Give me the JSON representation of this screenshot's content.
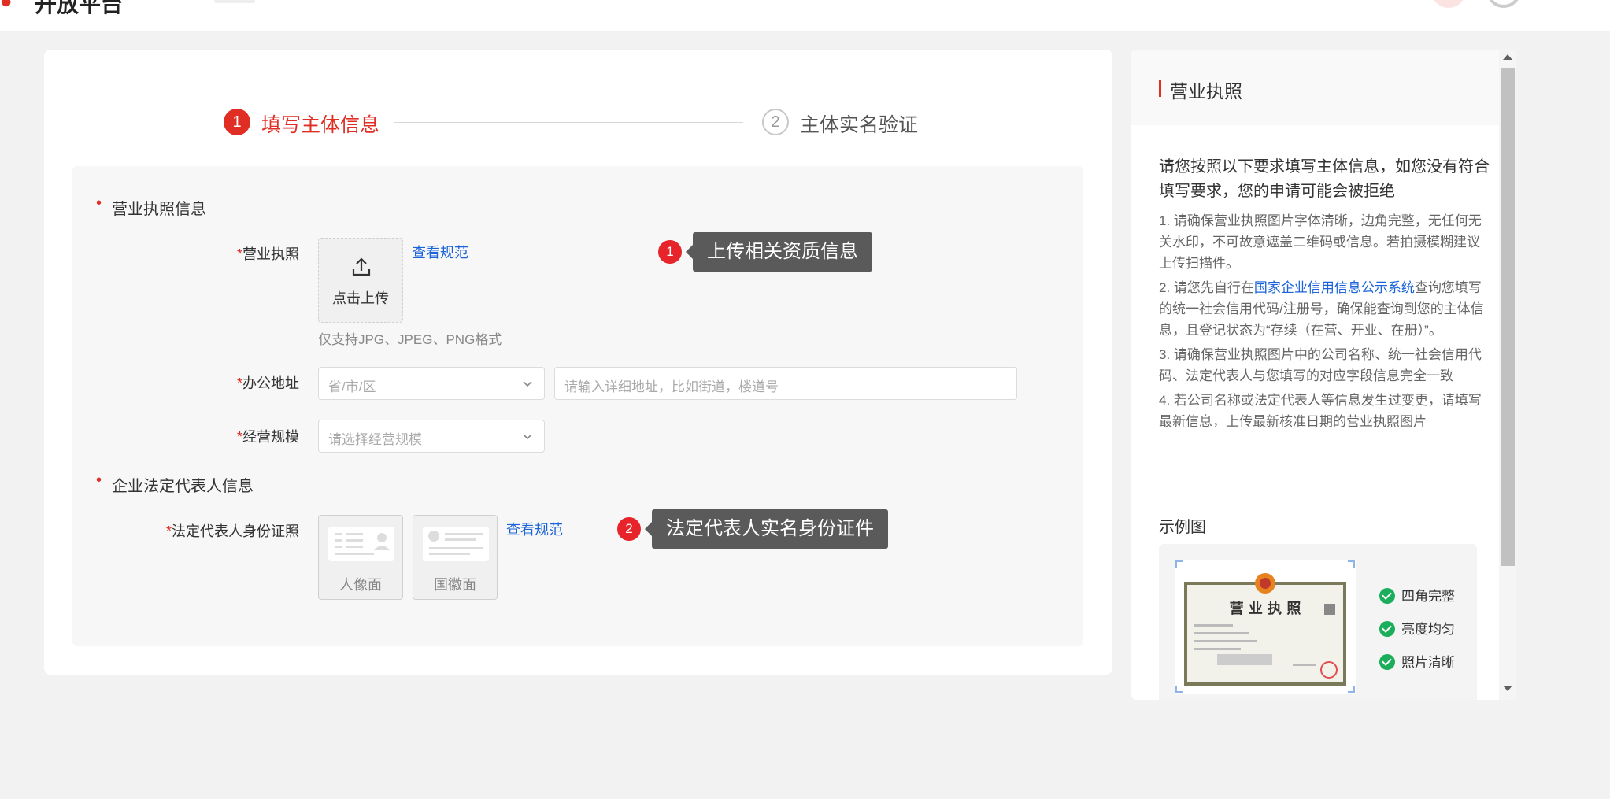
{
  "header": {
    "title_fragment": "开放平台",
    "tag": ""
  },
  "steps": [
    {
      "index": "1",
      "label": "填写主体信息",
      "active": true
    },
    {
      "index": "2",
      "label": "主体实名验证",
      "active": false
    }
  ],
  "sections": {
    "license": "营业执照信息",
    "legal_rep": "企业法定代表人信息"
  },
  "fields": {
    "license_label": "营业执照",
    "upload_text": "点击上传",
    "view_spec": "查看规范",
    "upload_hint": "仅支持JPG、JPEG、PNG格式",
    "address_label": "办公地址",
    "region_placeholder": "省/市/区",
    "address_placeholder": "请输入详细地址，比如街道，楼道号",
    "scale_label": "经营规模",
    "scale_placeholder": "请选择经营规模",
    "id_label": "法定代表人身份证照",
    "id_front": "人像面",
    "id_back": "国徽面",
    "required_mark": "*"
  },
  "callouts": [
    {
      "num": "1",
      "text": "上传相关资质信息"
    },
    {
      "num": "2",
      "text": "法定代表人实名身份证件"
    }
  ],
  "guide": {
    "title": "营业执照",
    "intro": "请您按照以下要求填写主体信息，如您没有符合填写要求，您的申请可能会被拒绝",
    "item1": "1. 请确保营业执照图片字体清晰，边角完整，无任何无关水印，不可故意遮盖二维码或信息。若拍摄模糊建议上传扫描件。",
    "item2_pre": "2. 请您先自行在",
    "item2_link": "国家企业信用信息公示系统",
    "item2_post": "查询您填写的统一社会信用代码/注册号，确保能查询到您的主体信息，且登记状态为“存续（在营、开业、在册）”。",
    "item3": "3. 请确保营业执照图片中的公司名称、统一社会信用代码、法定代表人与您填写的对应字段信息完全一致",
    "item4": "4. 若公司名称或法定代表人等信息发生过变更，请填写最新信息，上传最新核准日期的营业执照图片",
    "example_title": "示例图",
    "license_heading": "营 业 执 照",
    "checks": [
      "四角完整",
      "亮度均匀",
      "照片清晰"
    ]
  },
  "colors": {
    "accent": "#e02e24",
    "link": "#1a63d8",
    "check": "#1aad5a",
    "callout_bg": "#5a5a5a"
  }
}
